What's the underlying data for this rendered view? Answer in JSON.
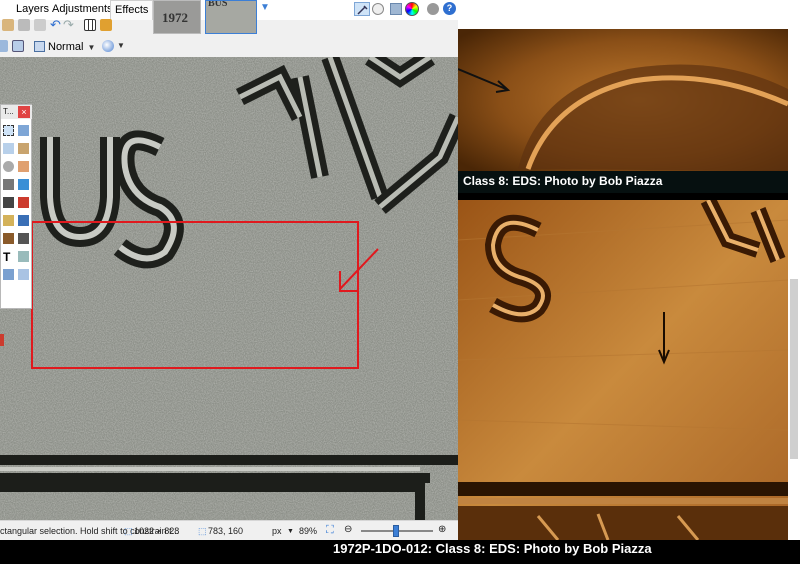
{
  "app": {
    "menus": [
      "Layers",
      "Adjustments",
      "Effects"
    ],
    "thumbnails": [
      {
        "text": "1972"
      },
      {
        "text": "BUS"
      }
    ],
    "blend_mode": "Normal",
    "tools_title": "T...",
    "tools_close": "×"
  },
  "statusbar": {
    "hint": "ctangular selection. Hold shift to constrain t...",
    "image_size": "1022 × 828",
    "cursor_pos": "783, 160",
    "unit": "px",
    "zoom": "89%"
  },
  "panels": {
    "top_caption": "Class 8:  EDS:  Photo by Bob Piazza",
    "bottom_caption": "1972P-1DO-012:  Class 8:  EDS:  Photo by Bob Piazza"
  },
  "colors": {
    "selection": "#e0191e",
    "accent": "#3c7fd6"
  }
}
